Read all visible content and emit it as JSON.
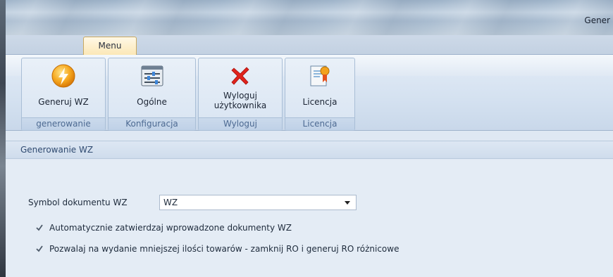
{
  "window": {
    "title": "Gener"
  },
  "ribbon": {
    "tab_label": "Menu",
    "groups": [
      {
        "button_label": "Generuj WZ",
        "group_label": "generowanie",
        "icon": "lightning-icon"
      },
      {
        "button_label": "Ogólne",
        "group_label": "Konfiguracja",
        "icon": "settings-sliders-icon"
      },
      {
        "button_label_line1": "Wyloguj",
        "button_label_line2": "użytkownika",
        "group_label": "Wyloguj",
        "icon": "red-x-icon"
      },
      {
        "button_label": "Licencja",
        "group_label": "Licencja",
        "icon": "certificate-icon"
      }
    ]
  },
  "section": {
    "title": "Generowanie WZ"
  },
  "form": {
    "symbol_label": "Symbol dokumentu WZ",
    "symbol_value": "WZ",
    "checkbox1_label": "Automatycznie zatwierdzaj wprowadzone dokumenty WZ",
    "checkbox1_checked": true,
    "checkbox2_label": "Pozwalaj na wydanie mniejszej ilości towarów - zamknij RO i generuj RO różnicowe",
    "checkbox2_checked": true
  },
  "colors": {
    "accent_tab": "#fbe7b5",
    "group_label_text": "#4d6a92",
    "section_text": "#2f4a70"
  }
}
